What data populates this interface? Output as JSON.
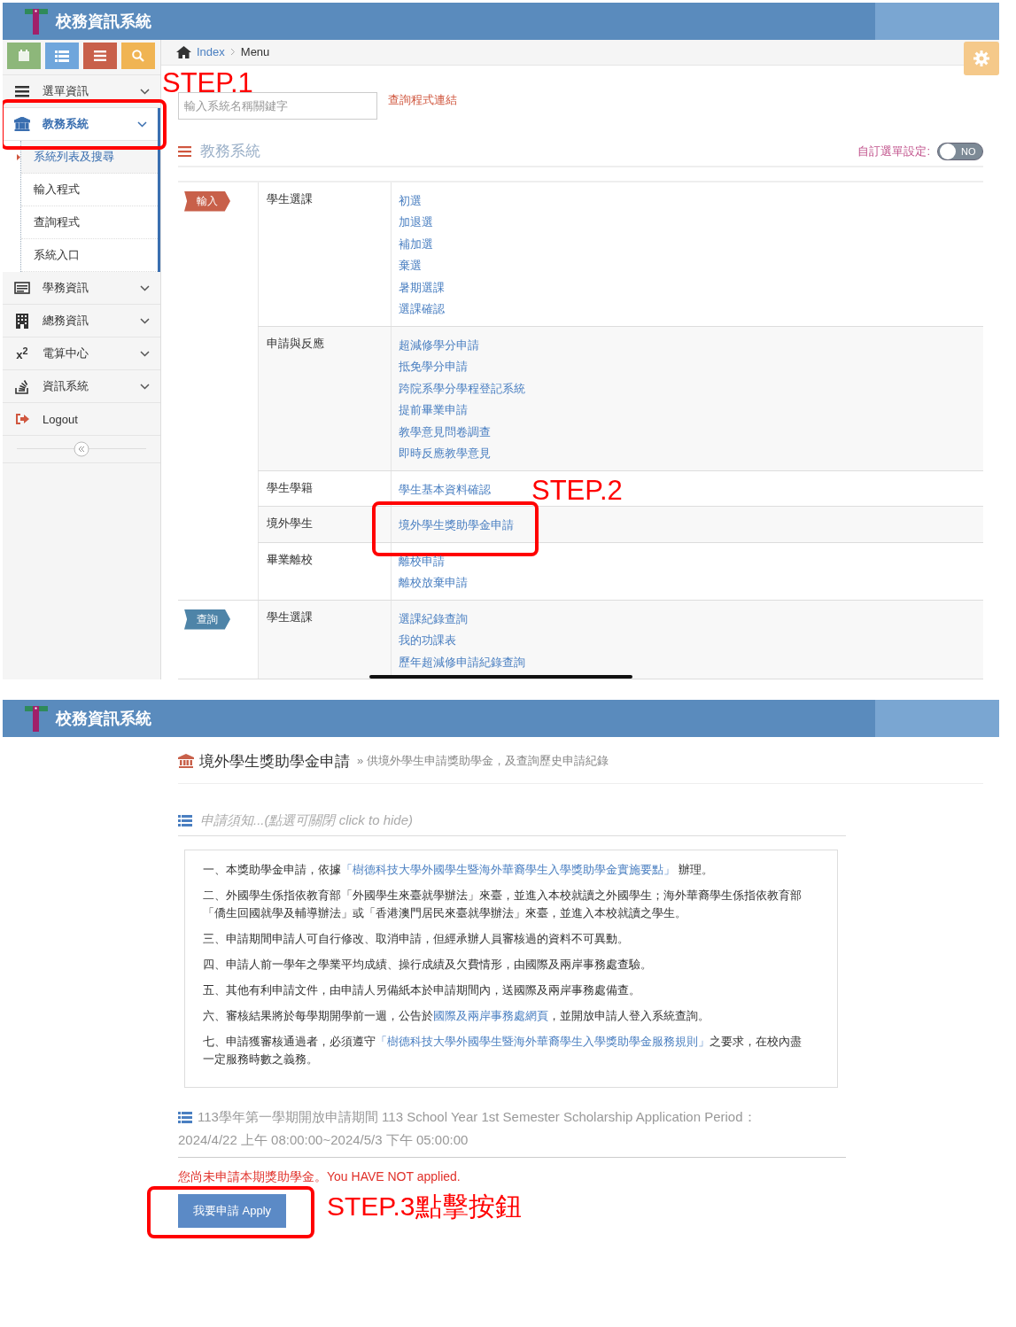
{
  "top": {
    "app_title": "校務資訊系統",
    "toolbar": [
      {
        "color": "#8db77a"
      },
      {
        "color": "#6fa6dc"
      },
      {
        "color": "#c8604a"
      },
      {
        "color": "#f0b453"
      }
    ],
    "breadcrumb": [
      "Index",
      "Menu"
    ],
    "sidebar": [
      {
        "label": "選單資訊",
        "selected": false,
        "expanded": false
      },
      {
        "label": "教務系統",
        "selected": true,
        "expanded": true,
        "highlight": {
          "label": "STEP.1"
        },
        "children": [
          {
            "label": "系統列表及搜尋",
            "selected": true
          },
          {
            "label": "輸入程式",
            "selected": false
          },
          {
            "label": "查詢程式",
            "selected": false
          },
          {
            "label": "系統入口",
            "selected": false
          }
        ]
      },
      {
        "label": "學務資訊",
        "selected": false,
        "expanded": false
      },
      {
        "label": "總務資訊",
        "selected": false,
        "expanded": false
      },
      {
        "label": "電算中心",
        "icon_text": "x$^{2}$",
        "selected": false,
        "expanded": false
      },
      {
        "label": "資訊系統",
        "selected": false,
        "expanded": false
      },
      {
        "label": "Logout",
        "kind": "logout",
        "selected": false
      }
    ],
    "search": {
      "placeholder": "輸入系統名稱關鍵字"
    },
    "search_link": "查詢程式連結",
    "section_title": "教務系統",
    "custom_menu": {
      "label": "自訂選單設定:",
      "toggle_text": "NO",
      "on": false
    },
    "groups": [
      {
        "tag": "輸入",
        "kind": "input",
        "rows": [
          {
            "category": "學生選課",
            "links": [
              {
                "text": "初選"
              },
              {
                "text": "加退選"
              },
              {
                "text": "補加選"
              },
              {
                "text": "棄選"
              },
              {
                "text": "暑期選課"
              },
              {
                "text": "選課確認"
              }
            ]
          },
          {
            "category": "申請與反應",
            "links": [
              {
                "text": "超減修學分申請"
              },
              {
                "text": "抵免學分申請"
              },
              {
                "text": "跨院系學分學程登記系統"
              },
              {
                "text": "提前畢業申請"
              },
              {
                "text": "教學意見問卷調查"
              },
              {
                "text": "即時反應教學意見"
              }
            ]
          },
          {
            "category": "學生學籍",
            "links": [
              {
                "text": "學生基本資料確認"
              }
            ]
          },
          {
            "category": "境外學生",
            "links": [
              {
                "text": "境外學生獎助學金申請",
                "highlight": {
                  "label": "STEP.2"
                }
              }
            ]
          },
          {
            "category": "畢業離校",
            "links": [
              {
                "text": "離校申請"
              },
              {
                "text": "離校放棄申請"
              }
            ]
          }
        ]
      },
      {
        "tag": "查詢",
        "kind": "query",
        "rows": [
          {
            "category": "學生選課",
            "links": [
              {
                "text": "選課紀錄查詢"
              },
              {
                "text": "我的功課表"
              },
              {
                "text": "歷年超減修申請紀錄查詢"
              }
            ]
          }
        ]
      }
    ]
  },
  "bottom": {
    "app_title": "校務資訊系統",
    "page_title": "境外學生獎助學金申請",
    "page_subtitle": "» 供境外學生申請獎助學金，及查詢歷史申請紀錄",
    "notice_toggle": "申請須知...(點選可關閉 click to hide)",
    "notice_items": [
      [
        {
          "text": "一、本獎助學金申請，依據"
        },
        {
          "link": "「樹德科技大學外國學生暨海外華裔學生入學獎助學金實施要點」"
        },
        {
          "text": " 辦理。"
        }
      ],
      [
        {
          "text": "二、外國學生係指依教育部「外國學生來臺就學辦法」來臺，並進入本校就讀之外國學生；海外華裔學生係指依教育部「僑生回國就學及輔導辦法」或「香港澳門居民來臺就學辦法」來臺，並進入本校就讀之學生。"
        }
      ],
      [
        {
          "text": "三、申請期間申請人可自行修改、取消申請，但經承辦人員審核過的資料不可異動。"
        }
      ],
      [
        {
          "text": "四、申請人前一學年之學業平均成績、操行成績及欠費情形，由國際及兩岸事務處查驗。"
        }
      ],
      [
        {
          "text": "五、其他有利申請文件，由申請人另備紙本於申請期間內，送國際及兩岸事務處備查。"
        }
      ],
      [
        {
          "text": "六、審核結果將於每學期開學前一週，公告於"
        },
        {
          "link": "國際及兩岸事務處網頁"
        },
        {
          "text": "，並開放申請人登入系統查詢。"
        }
      ],
      [
        {
          "text": "七、申請獲審核通過者，必須遵守"
        },
        {
          "link": "「樹德科技大學外國學生暨海外華裔學生入學獎助學金服務規則」"
        },
        {
          "text": "之要求，在校內盡一定服務時數之義務。"
        }
      ]
    ],
    "period_label": "113學年第一學期開放申請期間 113 School Year 1st Semester Scholarship Application Period：",
    "period_range": "2024/4/22 上午 08:00:00~2024/5/3 下午 05:00:00",
    "status": "您尚未申請本期獎助學金。You HAVE NOT applied.",
    "apply_button": "我要申請 Apply",
    "highlight": {
      "label": "STEP.3點擊按鈕"
    }
  }
}
